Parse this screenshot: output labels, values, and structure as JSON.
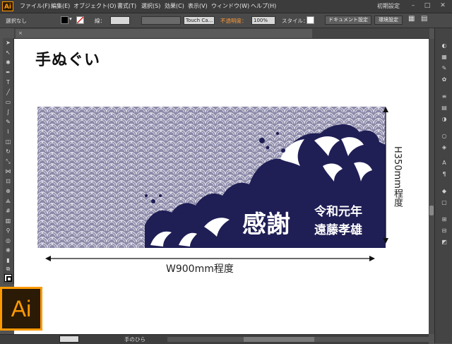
{
  "app": {
    "name": "Ai"
  },
  "menu": {
    "items": [
      "ファイル(F)",
      "編集(E)",
      "オブジェクト(O)",
      "書式(T)",
      "選択(S)",
      "効果(C)",
      "表示(V)",
      "ウィンドウ(W)",
      "ヘルプ(H)"
    ],
    "workspace": "初期設定"
  },
  "control_bar": {
    "selection_state": "選択なし",
    "stroke_label": "線：",
    "brush": "Touch Ca...",
    "opacity_label": "不透明度：",
    "opacity_value": "100%",
    "style_label": "スタイル：",
    "document_setup": "ドキュメント設定",
    "preferences": "環境設定"
  },
  "document": {
    "heading": "手ぬぐい",
    "design_text": {
      "main": "感謝",
      "sub1": "令和元年",
      "sub2": "遠藤孝雄"
    },
    "width_label": "W900mm程度",
    "height_label": "H350mm程度"
  },
  "status": {
    "zoom": "",
    "tool_label": "手のひら"
  },
  "colors": {
    "accent": "#ff9a00",
    "navy": "#1f1e55",
    "pattern": "#6f6c8e"
  }
}
